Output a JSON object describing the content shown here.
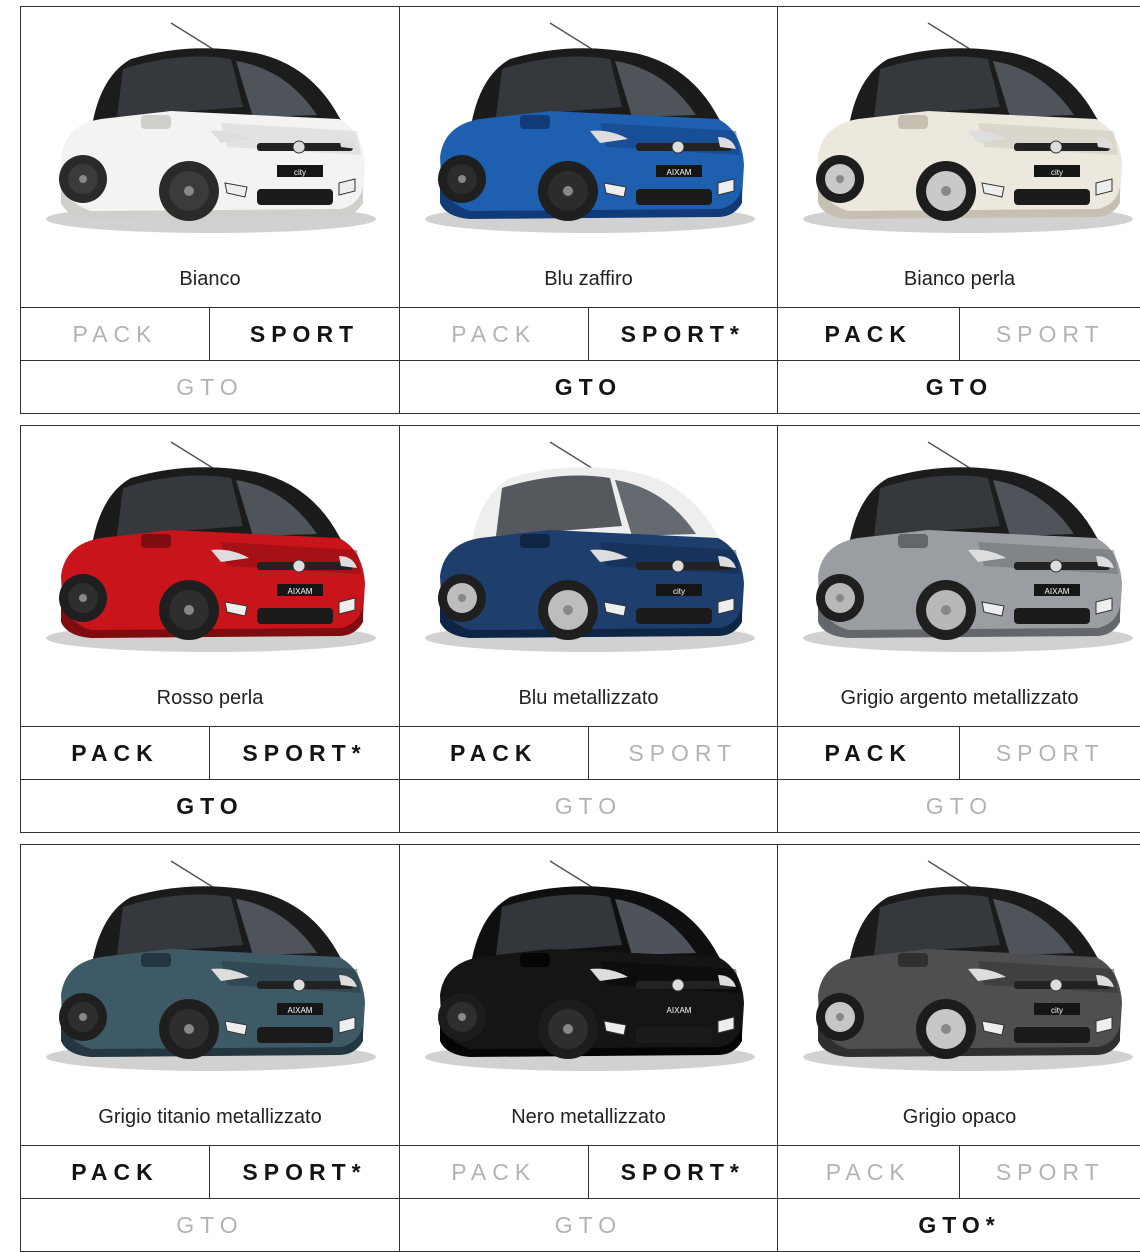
{
  "cards": [
    {
      "name": "Bianco",
      "body": "#f3f3f1",
      "shade": "#cfcfcc",
      "wheel": "#2a2a2a",
      "rim": "#3b3b3b",
      "roof": "#1c1c1c",
      "pack": {
        "label": "PACK",
        "state": "off"
      },
      "sport": {
        "label": "SPORT",
        "state": "on"
      },
      "gto": {
        "label": "GTO",
        "state": "off"
      }
    },
    {
      "name": "Blu zaffiro",
      "body": "#1f5fb0",
      "shade": "#103a78",
      "wheel": "#1f1f1f",
      "rim": "#2c2c2c",
      "roof": "#1b1b1b",
      "pack": {
        "label": "PACK",
        "state": "off"
      },
      "sport": {
        "label": "SPORT*",
        "state": "on"
      },
      "gto": {
        "label": "GTO",
        "state": "on"
      }
    },
    {
      "name": "Bianco perla",
      "body": "#ece8de",
      "shade": "#c6c0b3",
      "wheel": "#1d1d1d",
      "rim": "#c9c9c9",
      "roof": "#1c1c1c",
      "pack": {
        "label": "PACK",
        "state": "on"
      },
      "sport": {
        "label": "SPORT",
        "state": "off"
      },
      "gto": {
        "label": "GTO",
        "state": "on"
      }
    },
    {
      "name": "Rosso perla",
      "body": "#c9141b",
      "shade": "#7e0c10",
      "wheel": "#1f1f1f",
      "rim": "#2e2e2e",
      "roof": "#1b1b1b",
      "pack": {
        "label": "PACK",
        "state": "on"
      },
      "sport": {
        "label": "SPORT*",
        "state": "on"
      },
      "gto": {
        "label": "GTO",
        "state": "on"
      }
    },
    {
      "name": "Blu metallizzato",
      "body": "#1e3e6d",
      "shade": "#0f2546",
      "wheel": "#1f1f1f",
      "rim": "#bdbdbd",
      "roof": "#eeeeee",
      "pack": {
        "label": "PACK",
        "state": "on"
      },
      "sport": {
        "label": "SPORT",
        "state": "off"
      },
      "gto": {
        "label": "GTO",
        "state": "off"
      }
    },
    {
      "name": "Grigio argento metallizzato",
      "body": "#9a9ea3",
      "shade": "#63676c",
      "wheel": "#1f1f1f",
      "rim": "#b8b8b8",
      "roof": "#1c1c1c",
      "pack": {
        "label": "PACK",
        "state": "on"
      },
      "sport": {
        "label": "SPORT",
        "state": "off"
      },
      "gto": {
        "label": "GTO",
        "state": "off"
      }
    },
    {
      "name": "Grigio titanio metallizzato",
      "body": "#3e5a67",
      "shade": "#24363f",
      "wheel": "#1f1f1f",
      "rim": "#2e2e2e",
      "roof": "#1b1b1b",
      "pack": {
        "label": "PACK",
        "state": "on"
      },
      "sport": {
        "label": "SPORT*",
        "state": "on"
      },
      "gto": {
        "label": "GTO",
        "state": "off"
      }
    },
    {
      "name": "Nero metallizzato",
      "body": "#151515",
      "shade": "#050505",
      "wheel": "#1c1c1c",
      "rim": "#2e2e2e",
      "roof": "#0f0f0f",
      "pack": {
        "label": "PACK",
        "state": "off"
      },
      "sport": {
        "label": "SPORT*",
        "state": "on"
      },
      "gto": {
        "label": "GTO",
        "state": "off"
      }
    },
    {
      "name": "Grigio opaco",
      "body": "#4e4f51",
      "shade": "#2e2f31",
      "wheel": "#1c1c1c",
      "rim": "#c6c6c6",
      "roof": "#1b1b1b",
      "pack": {
        "label": "PACK",
        "state": "off"
      },
      "sport": {
        "label": "SPORT",
        "state": "off"
      },
      "gto": {
        "label": "GTO*",
        "state": "on"
      }
    }
  ],
  "car_badges": [
    "city",
    "AIXAM",
    "city",
    "AIXAM",
    "city",
    "AIXAM",
    "AIXAM",
    "AIXAM",
    "city"
  ]
}
